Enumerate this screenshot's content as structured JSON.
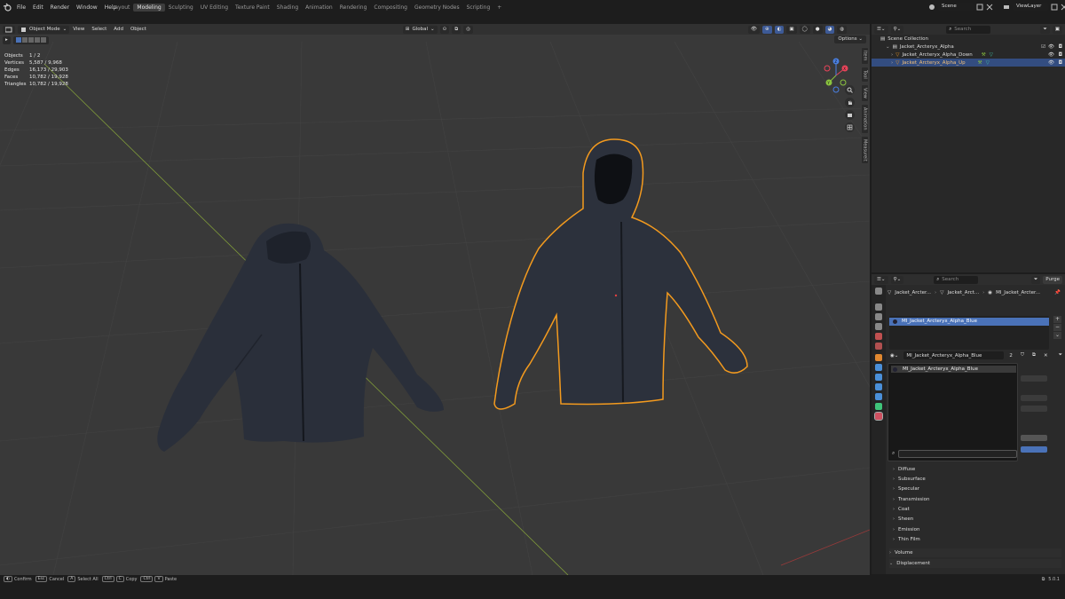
{
  "menubar": {
    "menus": [
      "File",
      "Edit",
      "Render",
      "Window",
      "Help"
    ],
    "workspaces": [
      "Layout",
      "Modeling",
      "Sculpting",
      "UV Editing",
      "Texture Paint",
      "Shading",
      "Animation",
      "Rendering",
      "Compositing",
      "Geometry Nodes",
      "Scripting"
    ],
    "active_workspace": "Modeling",
    "add_tab": "+",
    "scene_name": "Scene",
    "view_layer": "ViewLayer"
  },
  "viewport": {
    "mode": "Object Mode",
    "menus": [
      "View",
      "Select",
      "Add",
      "Object"
    ],
    "transform_orientation": "Global",
    "options_label": "Options",
    "stats": [
      {
        "label": "Objects",
        "value": "1 / 2"
      },
      {
        "label": "Vertices",
        "value": "5,587 / 9,968"
      },
      {
        "label": "Edges",
        "value": "16,173 / 29,903"
      },
      {
        "label": "Faces",
        "value": "10,782 / 19,928"
      },
      {
        "label": "Triangles",
        "value": "10,782 / 19,928"
      }
    ],
    "side_tabs": [
      "Item",
      "Tool",
      "View",
      "Animation",
      "Measureit"
    ],
    "gizmo_axes": {
      "x": "X",
      "y": "Y",
      "z": "Z"
    },
    "colors": {
      "background": "#393939",
      "selection_outline": "#f39a1e",
      "x_axis": "#e8445a",
      "y_axis": "#8bc43f",
      "z_axis": "#4a7fe0"
    }
  },
  "outliner": {
    "search_placeholder": "Search",
    "root": "Scene Collection",
    "collection": "Jacket_Arcteryx_Alpha",
    "objects": [
      {
        "name": "Jacket_Arcteryx_Alpha_Down",
        "selected": false
      },
      {
        "name": "Jacket_Arcteryx_Alpha_Up",
        "selected": true
      }
    ]
  },
  "properties": {
    "search_placeholder": "Search",
    "purge_label": "Purge",
    "breadcrumb": [
      "Jacket_Arcter...",
      "Jacket_Arct...",
      "MI_Jacket_Arcter..."
    ],
    "material_slot": "MI_Jacket_Arcteryx_Alpha_Blue",
    "material_field": "MI_Jacket_Arcteryx_Alpha_Blue",
    "user_count": "2",
    "dropdown_item": "MI_Jacket_Arcteryx_Alpha_Blue",
    "sections": [
      "Diffuse",
      "Subsurface",
      "Specular",
      "Transmission",
      "Coat",
      "Sheen",
      "Emission",
      "Thin Film"
    ],
    "bottom_sections": [
      "Volume",
      "Displacement"
    ]
  },
  "statusbar": {
    "hints": [
      {
        "key": "",
        "label": "Confirm"
      },
      {
        "key": "Esc",
        "label": "Cancel"
      },
      {
        "key": "A",
        "label": "Select All"
      },
      {
        "key": "Ctrl",
        "label": ""
      },
      {
        "key": "C",
        "label": "Copy"
      },
      {
        "key": "Ctrl",
        "label": ""
      },
      {
        "key": "V",
        "label": "Paste"
      }
    ],
    "version": "5.0.1"
  }
}
